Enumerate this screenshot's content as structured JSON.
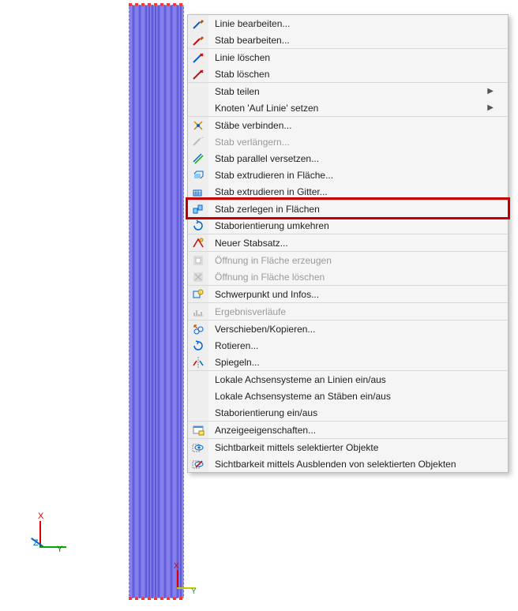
{
  "viewport": {
    "axis_labels": {
      "x": "X",
      "y": "Y",
      "z": "Z"
    },
    "small_axis_labels": {
      "x": "X",
      "y": "Y"
    }
  },
  "menu": {
    "items": [
      {
        "label": "Linie bearbeiten...",
        "icon": "edit-line",
        "group_first": false
      },
      {
        "label": "Stab bearbeiten...",
        "icon": "edit-member",
        "group_first": false
      },
      {
        "label": "Linie löschen",
        "icon": "delete-line",
        "group_first": true
      },
      {
        "label": "Stab löschen",
        "icon": "delete-member",
        "group_first": false
      },
      {
        "label": "Stab teilen",
        "icon": "",
        "group_first": true,
        "submenu": true
      },
      {
        "label": "Knoten 'Auf Linie' setzen",
        "icon": "",
        "group_first": false,
        "submenu": true
      },
      {
        "label": "Stäbe verbinden...",
        "icon": "connect-members",
        "group_first": true
      },
      {
        "label": "Stab verlängern...",
        "icon": "extend-member",
        "group_first": false,
        "disabled": true
      },
      {
        "label": "Stab parallel versetzen...",
        "icon": "offset-member",
        "group_first": false
      },
      {
        "label": "Stab extrudieren in Fläche...",
        "icon": "extrude-surface",
        "group_first": false
      },
      {
        "label": "Stab extrudieren in Gitter...",
        "icon": "extrude-grid",
        "group_first": false
      },
      {
        "label": "Stab zerlegen in Flächen",
        "icon": "explode-surfaces",
        "group_first": true,
        "highlighted": true
      },
      {
        "label": "Staborientierung umkehren",
        "icon": "reverse-orient",
        "group_first": false
      },
      {
        "label": "Neuer Stabsatz...",
        "icon": "new-memberset",
        "group_first": true
      },
      {
        "label": "Öffnung in Fläche erzeugen",
        "icon": "create-opening",
        "group_first": true,
        "disabled": true
      },
      {
        "label": "Öffnung in Fläche löschen",
        "icon": "delete-opening",
        "group_first": false,
        "disabled": true
      },
      {
        "label": "Schwerpunkt und Infos...",
        "icon": "centroid-info",
        "group_first": true
      },
      {
        "label": "Ergebnisverläufe",
        "icon": "result-diagram",
        "group_first": true,
        "disabled": true
      },
      {
        "label": "Verschieben/Kopieren...",
        "icon": "move-copy",
        "group_first": true
      },
      {
        "label": "Rotieren...",
        "icon": "rotate",
        "group_first": false
      },
      {
        "label": "Spiegeln...",
        "icon": "mirror",
        "group_first": false
      },
      {
        "label": "Lokale Achsensysteme an Linien ein/aus",
        "icon": "",
        "group_first": true
      },
      {
        "label": "Lokale Achsensysteme an Stäben ein/aus",
        "icon": "",
        "group_first": false
      },
      {
        "label": "Staborientierung ein/aus",
        "icon": "",
        "group_first": false
      },
      {
        "label": "Anzeigeeigenschaften...",
        "icon": "display-props",
        "group_first": true
      },
      {
        "label": "Sichtbarkeit mittels selektierter Objekte",
        "icon": "visibility-select",
        "group_first": true
      },
      {
        "label": "Sichtbarkeit mittels Ausblenden von selektierten Objekten",
        "icon": "visibility-hide",
        "group_first": false
      }
    ]
  },
  "colors": {
    "highlight_border": "#c00000"
  }
}
